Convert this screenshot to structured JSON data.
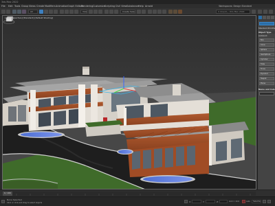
{
  "app": {
    "title": "3ds Max 2022"
  },
  "menu": {
    "items": [
      "File",
      "Edit",
      "Tools",
      "Group",
      "Views",
      "Create",
      "Modifiers",
      "Animation",
      "Graph Editors",
      "Rendering",
      "Customize",
      "Scripting",
      "Civil View",
      "Substance",
      "Help",
      "Arnold"
    ],
    "workspace": "Workspaces: Design Standard"
  },
  "toolbar": {
    "selection_set": "Create Selection Se",
    "project_path": "C:\\Users\\...\\3ds Max 2022"
  },
  "viewport": {
    "label": "[+] [Perspective] [Standard] [Default Shading]"
  },
  "command_panel": {
    "rollout_object_type": "Object Type",
    "autogrid": "AutoGrid",
    "buttons": [
      "Box",
      "Cone",
      "Sphere",
      "GeoSphere",
      "Cylinder",
      "Tube",
      "Torus",
      "Pyramid",
      "Teapot",
      "Plane"
    ],
    "rollout_name_color": "Name and Color",
    "category": "Standard Primitives"
  },
  "status": {
    "selection": "None Selected",
    "hint": "Click or click-and-drag to select objects",
    "x_label": "X:",
    "y_label": "Y:",
    "z_label": "Z:",
    "grid": "Grid = 10.0",
    "add_time_tag": "Add Time Tag",
    "auto_key": "Auto",
    "selected": "Selected",
    "set_key": "Set K."
  },
  "timeline": {
    "frame_counter": "0 / 100"
  },
  "colors": {
    "accent_blue": "#2a6ea8",
    "wood": "#a9542c",
    "roof": "#8f8f8f",
    "lawn": "#3f6b2a",
    "asphalt": "#1f1f1f",
    "pool": "#5b7de0"
  }
}
